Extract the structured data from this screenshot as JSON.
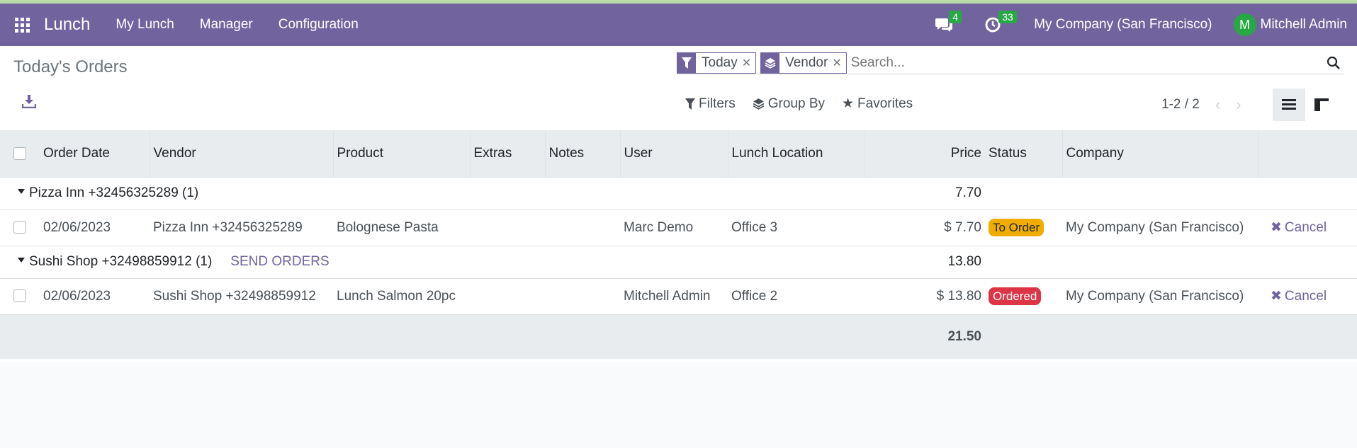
{
  "navbar": {
    "app_name": "Lunch",
    "menu": [
      "My Lunch",
      "Manager",
      "Configuration"
    ],
    "messages_count": "4",
    "activities_count": "33",
    "company": "My Company (San Francisco)",
    "avatar_letter": "M",
    "user": "Mitchell Admin"
  },
  "control_panel": {
    "title": "Today's Orders",
    "facets": [
      {
        "icon": "filter-icon",
        "value": "Today"
      },
      {
        "icon": "layers-icon",
        "value": "Vendor"
      }
    ],
    "search_placeholder": "Search...",
    "filters_label": "Filters",
    "groupby_label": "Group By",
    "favorites_label": "Favorites",
    "pager": "1-2 / 2"
  },
  "table": {
    "columns": [
      "Order Date",
      "Vendor",
      "Product",
      "Extras",
      "Notes",
      "User",
      "Lunch Location",
      "Price",
      "Status",
      "Company"
    ],
    "groups": [
      {
        "label": "Pizza Inn +32456325289 (1)",
        "subtotal": "7.70",
        "action": "",
        "rows": [
          {
            "date": "02/06/2023",
            "vendor": "Pizza Inn +32456325289",
            "product": "Bolognese Pasta",
            "extras": "",
            "notes": "",
            "user": "Marc Demo",
            "location": "Office 3",
            "price": "$ 7.70",
            "status": "To Order",
            "company": "My Company (San Francisco)",
            "action": "Cancel"
          }
        ]
      },
      {
        "label": "Sushi Shop +32498859912 (1)",
        "subtotal": "13.80",
        "action": "SEND ORDERS",
        "rows": [
          {
            "date": "02/06/2023",
            "vendor": "Sushi Shop +32498859912",
            "product": "Lunch Salmon 20pc",
            "extras": "",
            "notes": "",
            "user": "Mitchell Admin",
            "location": "Office 2",
            "price": "$ 13.80",
            "status": "Ordered",
            "company": "My Company (San Francisco)",
            "action": "Cancel"
          }
        ]
      }
    ],
    "total": "21.50"
  },
  "colors": {
    "brand": "#71639e",
    "to_order": "#f0ad00",
    "ordered": "#dc3545",
    "badge": "#28a745"
  }
}
